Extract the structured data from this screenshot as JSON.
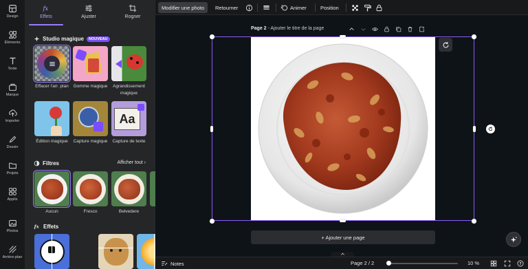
{
  "rail": {
    "items": [
      {
        "label": "Design",
        "icon": "design-icon"
      },
      {
        "label": "Éléments",
        "icon": "elements-icon"
      },
      {
        "label": "Texte",
        "icon": "text-icon"
      },
      {
        "label": "Marque",
        "icon": "brand-icon"
      },
      {
        "label": "Importer",
        "icon": "upload-icon"
      },
      {
        "label": "Dessin",
        "icon": "draw-icon"
      },
      {
        "label": "Projets",
        "icon": "folder-icon"
      },
      {
        "label": "Applis",
        "icon": "apps-icon"
      },
      {
        "label": "Photos",
        "icon": "photos-icon"
      },
      {
        "label": "Arrière-plan",
        "icon": "background-icon"
      }
    ]
  },
  "panel": {
    "tabs": [
      {
        "label": "Effets",
        "icon": "fx-icon",
        "active": true
      },
      {
        "label": "Ajuster",
        "icon": "sliders-icon",
        "active": false
      },
      {
        "label": "Rogner",
        "icon": "crop-icon",
        "active": false
      }
    ],
    "studio": {
      "title": "Studio magique",
      "badge": "NOUVEAU",
      "tools": [
        {
          "label": "Effacer l'arr. plan"
        },
        {
          "label": "Gomme magique"
        },
        {
          "label": "Agrandissement magique"
        },
        {
          "label": "Édition magique"
        },
        {
          "label": "Capture magique"
        },
        {
          "label": "Capture de texte"
        }
      ],
      "capture_text_glyph": "Aa"
    },
    "filters": {
      "title": "Filtres",
      "show_all": "Afficher tout",
      "items": [
        {
          "label": "Aucun"
        },
        {
          "label": "Fresco"
        },
        {
          "label": "Belvedere"
        }
      ]
    },
    "effects": {
      "title": "Effets"
    }
  },
  "toolbar": {
    "edit_photo": "Modifier une photo",
    "flip": "Retourner",
    "animate": "Animer",
    "position": "Position"
  },
  "page": {
    "label": "Page 2",
    "title_placeholder": "Ajouter le titre de la page",
    "add_page": "+ Ajouter une page"
  },
  "bottom": {
    "notes": "Notes",
    "page_counter": "Page 2 / 2",
    "zoom": "10 %",
    "zoom_fraction": 0.03
  },
  "colors": {
    "accent": "#8b5cf6",
    "panel_bg": "#252627",
    "canvas_bg": "#0e1318"
  }
}
